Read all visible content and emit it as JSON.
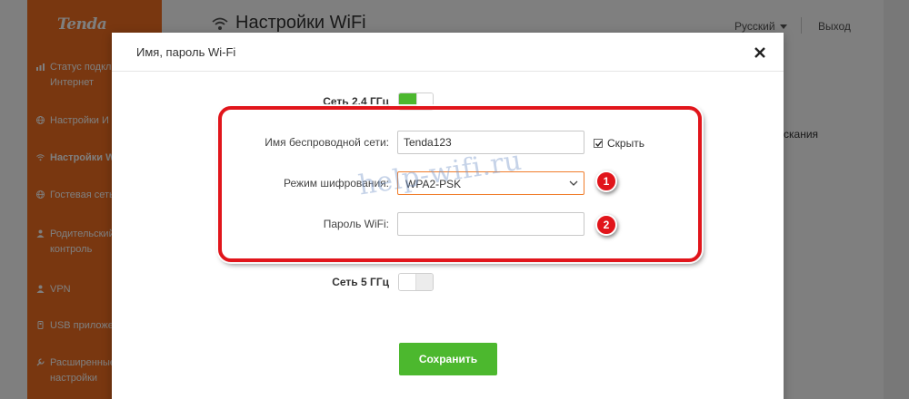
{
  "brand": {
    "logo_text": "Tenda",
    "accent_color": "#f26f21"
  },
  "sidebar": {
    "items": [
      {
        "line1": "Статус подкл",
        "line2": "Интернет",
        "icon": "bars-icon"
      },
      {
        "line1": "Настройки И",
        "line2": "",
        "icon": "globe-icon"
      },
      {
        "line1": "Настройки W",
        "line2": "",
        "icon": "wifi-icon",
        "active": true
      },
      {
        "line1": "Гостевая сеть",
        "line2": "",
        "icon": "globe-icon"
      },
      {
        "line1": "Родительский",
        "line2": "контроль",
        "icon": "person-icon"
      },
      {
        "line1": "VPN",
        "line2": "",
        "icon": "person-icon"
      },
      {
        "line1": "USB приложе",
        "line2": "",
        "icon": "usb-icon"
      },
      {
        "line1": "Расширенные",
        "line2": "настройки",
        "icon": "wrench-icon"
      }
    ]
  },
  "header": {
    "title": "Настройки WiFi",
    "language": "Русский",
    "logout": "Выход",
    "background_cut_text": "скания"
  },
  "modal": {
    "title": "Имя, пароль Wi-Fi",
    "close_icon": "close-icon",
    "band_24": {
      "label": "Сеть 2.4 ГГц",
      "enabled": true
    },
    "ssid": {
      "label": "Имя беспроводной сети:",
      "value": "Tenda123"
    },
    "hide": {
      "label": "Скрыть",
      "checked": true
    },
    "encryption": {
      "label": "Режим шифрования:",
      "value": "WPA2-PSK"
    },
    "password": {
      "label": "Пароль WiFi:",
      "value": ""
    },
    "band_5": {
      "label": "Сеть 5 ГГц",
      "enabled": false
    },
    "save_label": "Сохранить"
  },
  "annotations": {
    "badge_1": "1",
    "badge_2": "2",
    "watermark": "help-wifi.ru",
    "frame_color": "#e1151b",
    "save_color": "#4cb82e"
  }
}
